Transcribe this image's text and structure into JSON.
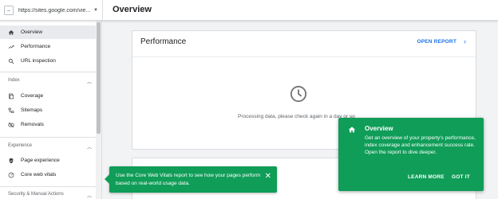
{
  "header": {
    "property_url": "https://sites.google.com/vie...",
    "title": "Overview"
  },
  "sidebar": {
    "items_top": [
      {
        "label": "Overview",
        "icon": "home-icon",
        "active": true
      },
      {
        "label": "Performance",
        "icon": "trending-up-icon"
      },
      {
        "label": "URL inspection",
        "icon": "search-icon"
      }
    ],
    "index_section": "Index",
    "index_items": [
      {
        "label": "Coverage",
        "icon": "coverage-icon"
      },
      {
        "label": "Sitemaps",
        "icon": "sitemap-icon"
      },
      {
        "label": "Removals",
        "icon": "removals-icon"
      }
    ],
    "experience_section": "Experience",
    "experience_items": [
      {
        "label": "Page experience",
        "icon": "page-experience-icon"
      },
      {
        "label": "Core web vitals",
        "icon": "speed-icon"
      }
    ],
    "security_section": "Security & Manual Actions"
  },
  "main": {
    "card_title": "Performance",
    "open_report": "OPEN REPORT",
    "processing_text": "Processing data, please check again in a day or so"
  },
  "tip_small": {
    "text": "Use the Core Web Vitals report to see how your pages perform based on real-world usage data."
  },
  "tip_big": {
    "title": "Overview",
    "body": "Get an overview of your property's performance, index coverage and enhancement success rate. Open the report to dive deeper.",
    "learn_more": "LEARN MORE",
    "got_it": "GOT IT"
  },
  "colors": {
    "accent": "#1a73e8",
    "tooltip_green": "#0f9d58",
    "active_bg": "#e8eaed"
  }
}
